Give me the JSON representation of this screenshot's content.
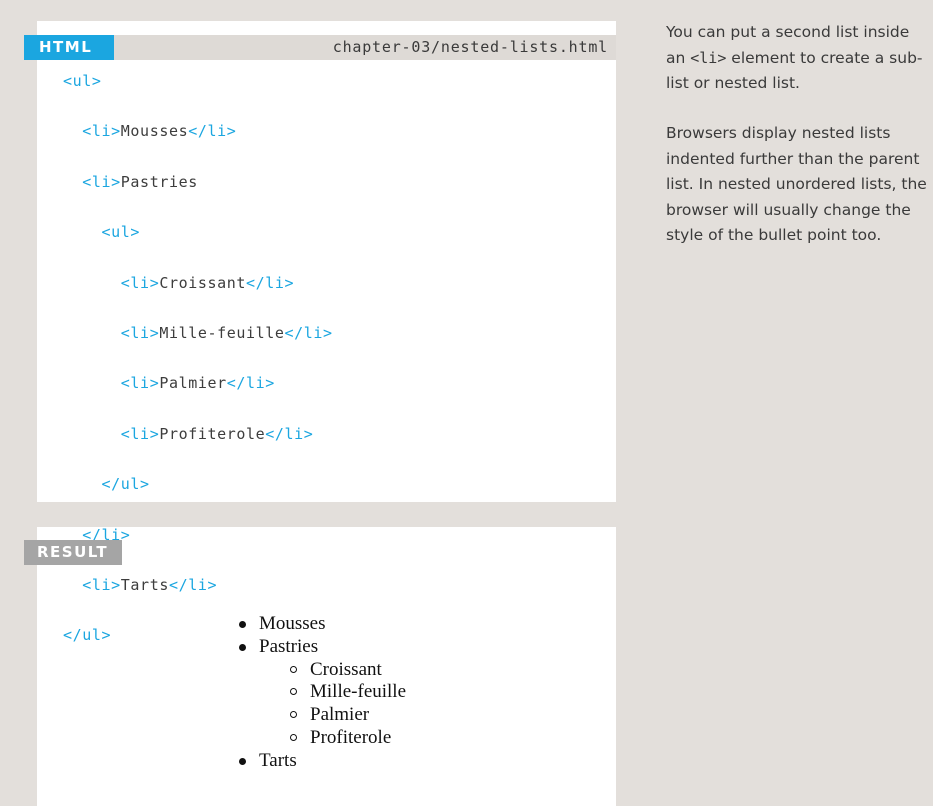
{
  "code_example": {
    "label": "HTML",
    "filename": "chapter-03/nested-lists.html",
    "lines": [
      {
        "indent": "",
        "open": "<ul>",
        "text": "",
        "close": ""
      },
      {
        "indent": "  ",
        "open": "<li>",
        "text": "Mousses",
        "close": "</li>"
      },
      {
        "indent": "  ",
        "open": "<li>",
        "text": "Pastries",
        "close": ""
      },
      {
        "indent": "    ",
        "open": "<ul>",
        "text": "",
        "close": ""
      },
      {
        "indent": "      ",
        "open": "<li>",
        "text": "Croissant",
        "close": "</li>"
      },
      {
        "indent": "      ",
        "open": "<li>",
        "text": "Mille-feuille",
        "close": "</li>"
      },
      {
        "indent": "      ",
        "open": "<li>",
        "text": "Palmier",
        "close": "</li>"
      },
      {
        "indent": "      ",
        "open": "<li>",
        "text": "Profiterole",
        "close": "</li>"
      },
      {
        "indent": "    ",
        "open": "</ul>",
        "text": "",
        "close": ""
      },
      {
        "indent": "  ",
        "open": "</li>",
        "text": "",
        "close": ""
      },
      {
        "indent": "  ",
        "open": "<li>",
        "text": "Tarts",
        "close": "</li>"
      },
      {
        "indent": "",
        "open": "</ul>",
        "text": "",
        "close": ""
      }
    ]
  },
  "result": {
    "label": "RESULT",
    "items": [
      {
        "text": "Mousses",
        "level": 1,
        "bullet": "disc"
      },
      {
        "text": "Pastries",
        "level": 1,
        "bullet": "disc"
      },
      {
        "text": "Croissant",
        "level": 2,
        "bullet": "circle"
      },
      {
        "text": "Mille-feuille",
        "level": 2,
        "bullet": "circle"
      },
      {
        "text": "Palmier",
        "level": 2,
        "bullet": "circle"
      },
      {
        "text": "Profiterole",
        "level": 2,
        "bullet": "circle"
      },
      {
        "text": "Tarts",
        "level": 1,
        "bullet": "disc"
      }
    ]
  },
  "sidebar": {
    "paragraph1": {
      "before": "You can put a second list inside an ",
      "code": "<li>",
      "after": " element to create a sub-list or nested list."
    },
    "paragraph2": "Browsers display nested lists indented further than the parent list. In nested unordered lists, the browser will usually change the style of the bullet point too."
  },
  "colors": {
    "page_background": "#e3dfdb",
    "accent_blue": "#1ba6e0",
    "result_label_gray": "#a5a5a5",
    "panel_white": "#ffffff"
  }
}
